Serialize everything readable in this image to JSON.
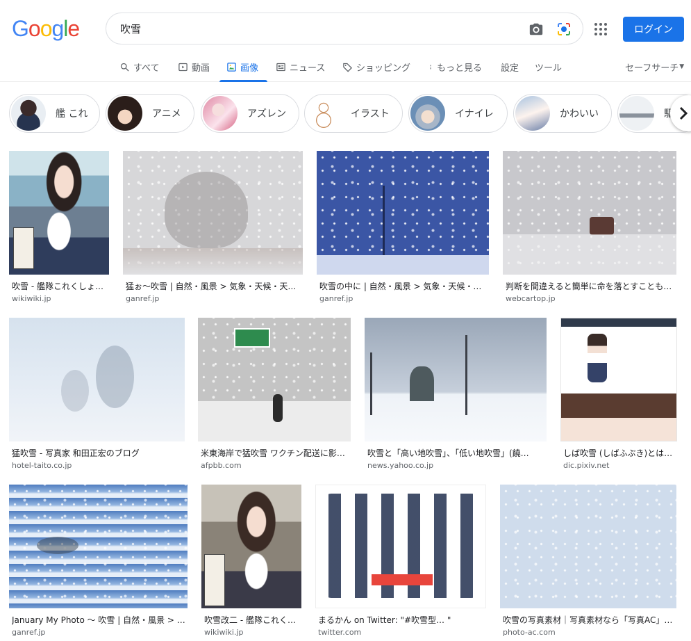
{
  "header": {
    "logo_text": "Google",
    "search_query": "吹雪",
    "login_label": "ログイン"
  },
  "tabs": [
    {
      "label": "すべて",
      "icon": "search-icon"
    },
    {
      "label": "動画",
      "icon": "video-icon"
    },
    {
      "label": "画像",
      "icon": "image-icon",
      "active": true
    },
    {
      "label": "ニュース",
      "icon": "news-icon"
    },
    {
      "label": "ショッピング",
      "icon": "tag-icon"
    },
    {
      "label": "もっと見る",
      "icon": "more-vert-icon"
    }
  ],
  "tools": {
    "settings_label": "設定",
    "tools_label": "ツール",
    "safesearch_label": "セーフサーチ"
  },
  "chips": [
    {
      "label": "艦 これ"
    },
    {
      "label": "アニメ"
    },
    {
      "label": "アズレン"
    },
    {
      "label": "イラスト"
    },
    {
      "label": "イナイレ"
    },
    {
      "label": "かわいい"
    },
    {
      "label": "駆"
    }
  ],
  "results": [
    {
      "title": "吹雪 - 艦隊これくしょ…",
      "source": "wikiwiki.jp"
    },
    {
      "title": "猛ぉ～吹雪 | 自然・風景 > 気象・天候・天…",
      "source": "ganref.jp"
    },
    {
      "title": "吹雪の中に | 自然・風景 > 気象・天候・…",
      "source": "ganref.jp"
    },
    {
      "title": "判断を間違えると簡単に命を落とすことも…",
      "source": "webcartop.jp"
    },
    {
      "title": "猛吹雪 - 写真家 和田正宏のブログ",
      "source": "hotel-taito.co.jp"
    },
    {
      "title": "米東海岸で猛吹雪 ワクチン配送に影…",
      "source": "afpbb.com"
    },
    {
      "title": "吹雪と「高い地吹雪」、「低い地吹雪」(饒…",
      "source": "news.yahoo.co.jp"
    },
    {
      "title": "しば吹雪 (しばふぶき)とは…",
      "source": "dic.pixiv.net"
    },
    {
      "title": "January My Photo ～ 吹雪 | 自然・風景 > …",
      "source": "ganref.jp"
    },
    {
      "title": "吹雪改二 - 艦隊これく…",
      "source": "wikiwiki.jp"
    },
    {
      "title": "まるかん on Twitter: \"#吹雪型… \"",
      "source": "twitter.com"
    },
    {
      "title": "吹雪の写真素材｜写真素材なら「写真AC」…",
      "source": "photo-ac.com"
    }
  ],
  "colors": {
    "accent": "#1a73e8",
    "logo_blue": "#4285f4",
    "logo_red": "#ea4335",
    "logo_yellow": "#fbbc05",
    "logo_green": "#34a853"
  }
}
